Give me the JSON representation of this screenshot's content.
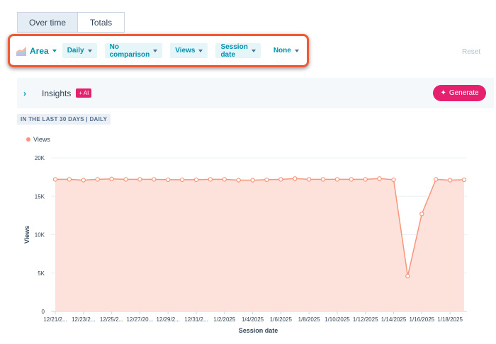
{
  "tabs": [
    {
      "label": "Over time",
      "active": true
    },
    {
      "label": "Totals",
      "active": false
    }
  ],
  "toolbar": {
    "chart_type": "Area",
    "frequency": "Daily",
    "comparison": "No comparison",
    "metric": "Views",
    "dimension": "Session date",
    "breakdown": "None",
    "reset_label": "Reset",
    "highlight_color": "#ef5a34"
  },
  "insights": {
    "label": "Insights",
    "ai_badge": "+ AI",
    "generate_label": "Generate"
  },
  "range_label": "IN THE LAST 30 DAYS | DAILY",
  "colors": {
    "accent": "#0091ae",
    "series_line": "#f8957a",
    "series_fill": "#fde2dc",
    "generate": "#e5216f"
  },
  "chart_data": {
    "type": "area",
    "xlabel": "Session date",
    "ylabel": "Views",
    "ylim": [
      0,
      20000
    ],
    "yticks": [
      0,
      5000,
      10000,
      15000,
      20000
    ],
    "ytick_labels": [
      "0",
      "5K",
      "10K",
      "15K",
      "20K"
    ],
    "legend": "top-left",
    "x_tick_labels": [
      "12/21/2...",
      "12/23/2...",
      "12/25/2...",
      "12/27/20...",
      "12/29/2...",
      "12/31/2...",
      "1/2/2025",
      "1/4/2025",
      "1/6/2025",
      "1/8/2025",
      "1/10/2025",
      "1/12/2025",
      "1/14/2025",
      "1/16/2025",
      "1/18/2025"
    ],
    "series": [
      {
        "name": "Views",
        "values": [
          17200,
          17200,
          17100,
          17200,
          17250,
          17200,
          17200,
          17200,
          17150,
          17150,
          17150,
          17200,
          17200,
          17100,
          17100,
          17150,
          17200,
          17300,
          17200,
          17200,
          17200,
          17200,
          17200,
          17300,
          17150,
          4600,
          12700,
          17200,
          17100,
          17150
        ]
      }
    ]
  }
}
